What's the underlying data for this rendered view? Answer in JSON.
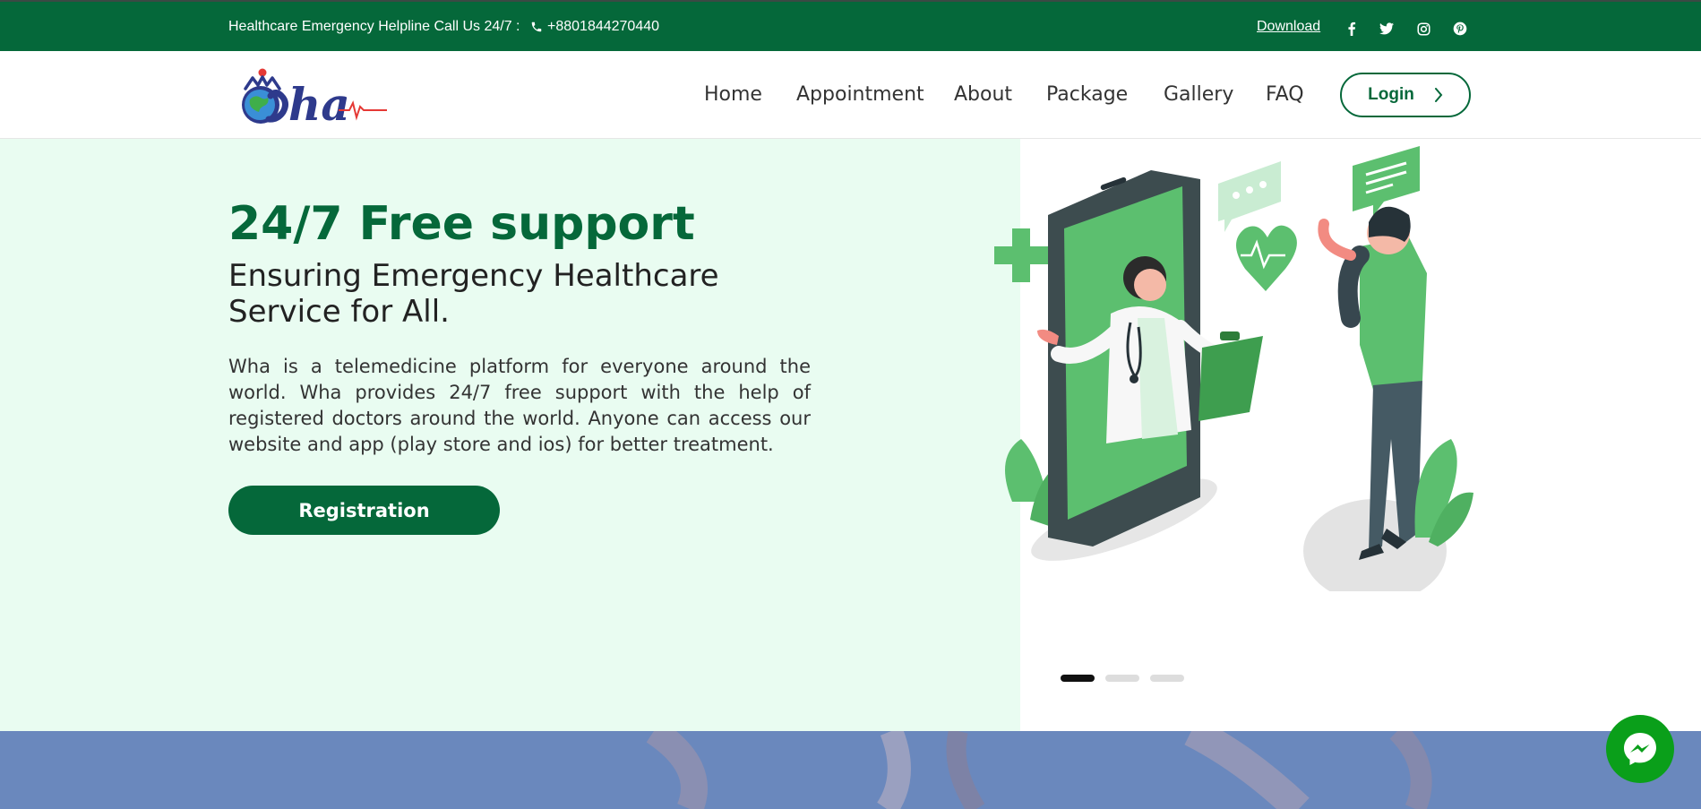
{
  "topbar": {
    "helpline": "Healthcare Emergency Helpline Call Us 24/7 :",
    "phone": "+8801844270440",
    "download": "Download",
    "social": [
      "facebook-icon",
      "twitter-icon",
      "instagram-icon",
      "pinterest-icon"
    ]
  },
  "nav": {
    "items": [
      "Home",
      "Appointment",
      "About",
      "Package",
      "Gallery",
      "FAQ"
    ],
    "login": "Login"
  },
  "hero": {
    "title": "24/7 Free support",
    "subtitle": "Ensuring Emergency Healthcare Service for All.",
    "description": "Wha is a telemedicine platform for everyone around the world. Wha provides 24/7 free support with the help of registered doctors around the world. Anyone can access our website and app (play store and ios) for better treatment.",
    "cta": "Registration",
    "slides": 3,
    "active_slide": 1
  },
  "colors": {
    "brand_green": "#05683a",
    "hero_bg": "#e9fcf1",
    "illustration_green": "#5cbf6f",
    "messenger": "#0a9f1a"
  }
}
